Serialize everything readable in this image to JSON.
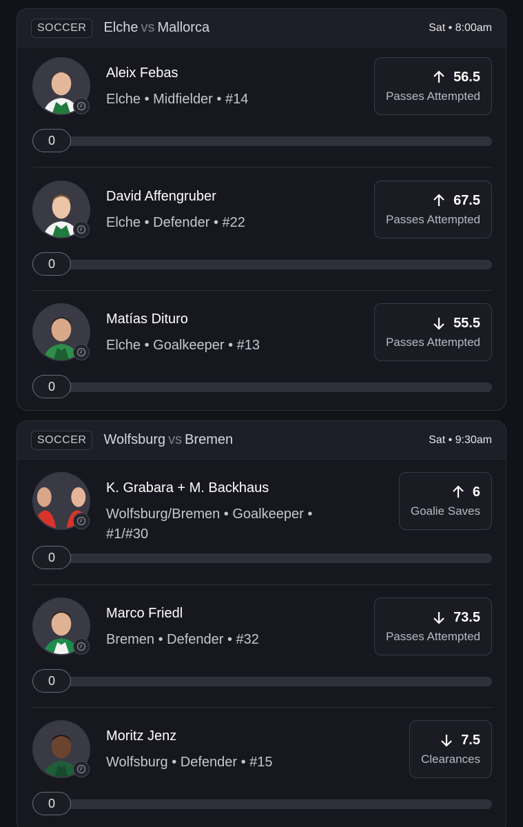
{
  "games": [
    {
      "sport": "SOCCER",
      "home": "Elche",
      "vs": "vs",
      "away": "Mallorca",
      "time": "Sat • 8:00am",
      "players": [
        {
          "name": "Aleix Febas",
          "meta": "Elche • Midfielder • #14",
          "direction": "up",
          "line": "56.5",
          "stat": "Passes Attempted",
          "progress": "0",
          "kit": "green-white"
        },
        {
          "name": "David Affengruber",
          "meta": "Elche • Defender • #22",
          "direction": "up",
          "line": "67.5",
          "stat": "Passes Attempted",
          "progress": "0",
          "kit": "green-white"
        },
        {
          "name": "Matías Dituro",
          "meta": "Elche • Goalkeeper • #13",
          "direction": "down",
          "line": "55.5",
          "stat": "Passes Attempted",
          "progress": "0",
          "kit": "green"
        }
      ]
    },
    {
      "sport": "SOCCER",
      "home": "Wolfsburg",
      "vs": "vs",
      "away": "Bremen",
      "time": "Sat • 9:30am",
      "players": [
        {
          "name": "K. Grabara + M. Backhaus",
          "meta": "Wolfsburg/Bremen • Goalkeeper • #1/#30",
          "direction": "up",
          "line": "6",
          "stat": "Goalie Saves",
          "progress": "0",
          "kit": "red-duo"
        },
        {
          "name": "Marco Friedl",
          "meta": "Bremen • Defender • #32",
          "direction": "down",
          "line": "73.5",
          "stat": "Passes Attempted",
          "progress": "0",
          "kit": "green-white"
        },
        {
          "name": "Moritz Jenz",
          "meta": "Wolfsburg • Defender • #15",
          "direction": "down",
          "line": "7.5",
          "stat": "Clearances",
          "progress": "0",
          "kit": "green-dark"
        }
      ]
    }
  ],
  "colors": {
    "background": "#121219",
    "card": "#17171f",
    "header": "#1e1e28",
    "track": "#30303a"
  },
  "icons": {
    "up": "arrow-up-icon",
    "down": "arrow-down-icon",
    "badge": "clock-icon"
  }
}
